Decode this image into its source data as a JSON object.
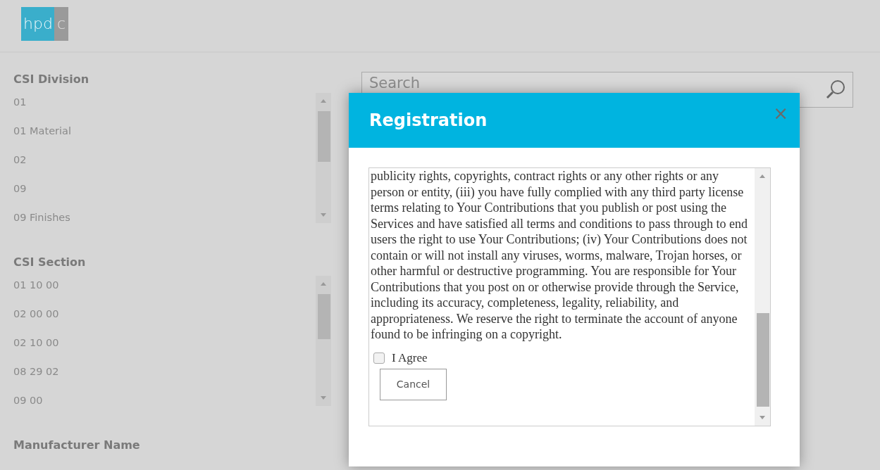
{
  "logo": {
    "left": "hpd",
    "right": "c"
  },
  "filters": [
    {
      "title": "CSI Division",
      "items": [
        "01",
        "01 Material",
        "02",
        "09",
        "09 Finishes"
      ]
    },
    {
      "title": "CSI Section",
      "items": [
        "01 10 00",
        "02 00 00",
        "02 10 00",
        "08 29 02",
        "09 00"
      ]
    },
    {
      "title": "Manufacturer Name"
    }
  ],
  "search": {
    "placeholder": "Search"
  },
  "dialog": {
    "title": "Registration",
    "close": "×",
    "terms": "publicity rights, copyrights, contract rights or any other rights or any person or entity, (iii) you have fully complied with any third party license terms relating to Your Contributions that you publish or post using the Services and have satisfied all terms and conditions to pass through to end users the right to use Your Contributions; (iv) Your Contributions does not contain or will not install any viruses, worms, malware, Trojan horses, or other harmful or destructive programming. You are responsible for Your Contributions that you post on or otherwise provide through the Service, including its accuracy, completeness, legality, reliability, and appropriateness. We reserve the right to terminate the account of anyone found to be infringing on a copyright.",
    "agree": {
      "label": "I Agree",
      "checked": false
    },
    "buttons": [
      "Cancel"
    ]
  }
}
